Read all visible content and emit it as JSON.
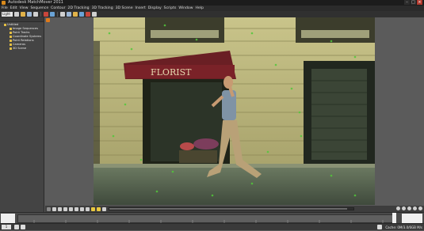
{
  "window": {
    "title": "Autodesk MatchMover 2011"
  },
  "menubar": {
    "items": [
      "File",
      "Edit",
      "View",
      "Sequence",
      "Contour",
      "2D Tracking",
      "3D Tracking",
      "3D Scene",
      "Insert",
      "Display",
      "Scripts",
      "Window",
      "Help"
    ]
  },
  "toolbar": {
    "mode_value": "Light"
  },
  "project_tree": {
    "root": "Untitled",
    "children": [
      "Image Sequences",
      "Point Tracks",
      "Coordinate Systems",
      "Point Relations",
      "Cameras",
      "3D Scene"
    ]
  },
  "viewport": {
    "sign_text": "FLORIST"
  },
  "status": {
    "frame_value": "1",
    "info_text": "Cache: 0M/3.0/6GB M/s"
  },
  "colors": {
    "folder": "#e5c043",
    "accent": "#e07a1a",
    "menubar_bg": "#2b2b2b",
    "panel_bg": "#444444"
  }
}
